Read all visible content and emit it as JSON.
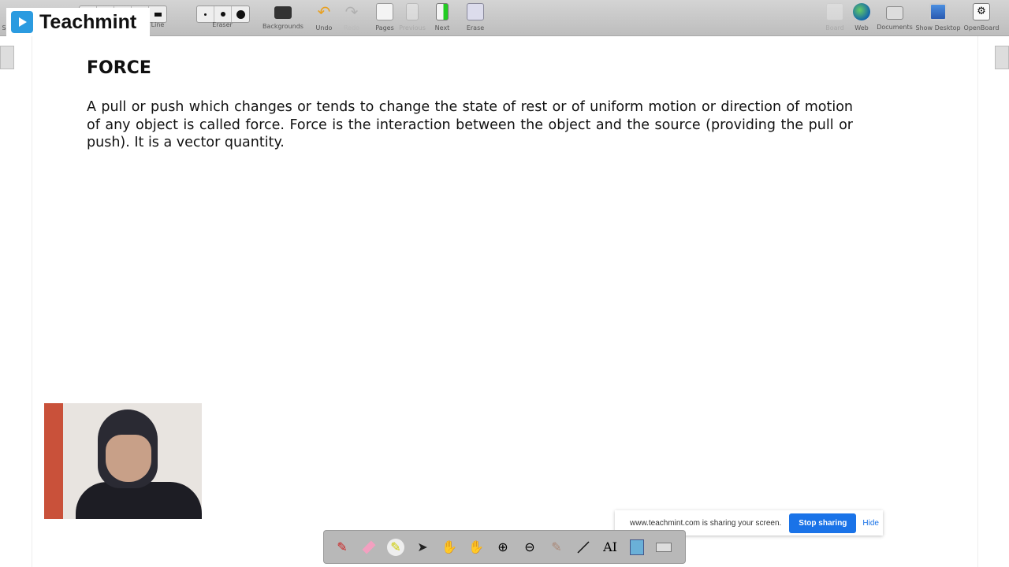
{
  "app": {
    "logo_text": "Teachmint"
  },
  "toolbar": {
    "items": [
      {
        "label": "S",
        "icon": "stylus-icon"
      },
      {
        "label": "Line",
        "icon": "line-width-icon"
      },
      {
        "label": "Eraser",
        "icon": "eraser-size-icon"
      },
      {
        "label": "Backgrounds",
        "icon": "backgrounds-icon"
      },
      {
        "label": "Undo",
        "icon": "undo-icon"
      },
      {
        "label": "Redo",
        "icon": "redo-icon",
        "disabled": true
      },
      {
        "label": "Pages",
        "icon": "new-page-icon"
      },
      {
        "label": "Previous",
        "icon": "previous-page-icon",
        "disabled": true
      },
      {
        "label": "Next",
        "icon": "next-page-icon"
      },
      {
        "label": "Erase",
        "icon": "erase-all-icon"
      },
      {
        "label": "Board",
        "icon": "board-icon",
        "disabled": true
      },
      {
        "label": "Web",
        "icon": "globe-icon"
      },
      {
        "label": "Documents",
        "icon": "folder-icon"
      },
      {
        "label": "Show Desktop",
        "icon": "desktop-icon"
      },
      {
        "label": "OpenBoard",
        "icon": "settings-icon"
      }
    ]
  },
  "slide": {
    "title": "FORCE",
    "body": "A pull or push which changes or tends to change the state of rest or of uniform motion or direction of motion of any object is called force. Force is the interaction between the object and the source (providing the pull or push). It is a vector quantity."
  },
  "share_bar": {
    "message": "www.teachmint.com is sharing your screen.",
    "stop_label": "Stop sharing",
    "hide_label": "Hide",
    "accent": "#1a73e8"
  },
  "bottom_tools": [
    "pen-icon",
    "eraser-icon",
    "highlighter-icon",
    "pointer-icon",
    "hand-icon",
    "pan-icon",
    "zoom-in-icon",
    "zoom-out-icon",
    "laser-icon",
    "line-icon",
    "text-icon",
    "capture-icon",
    "keyboard-icon"
  ]
}
